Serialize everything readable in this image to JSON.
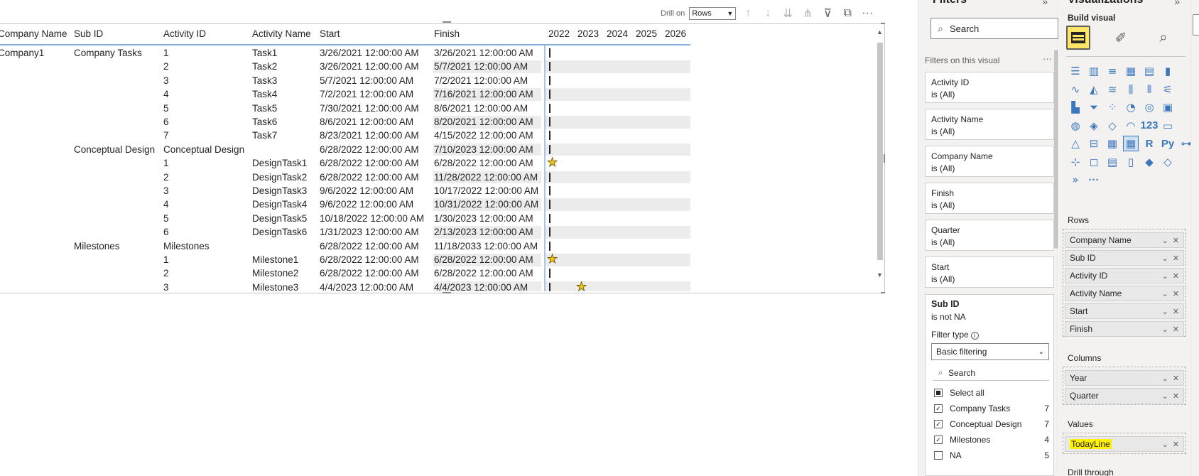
{
  "toolbar": {
    "drill_on_label": "Drill on",
    "drill_on_value": "Rows",
    "icons": [
      "drill-up-icon",
      "drill-down-icon",
      "expand-all-icon",
      "expand-hierarchy-icon",
      "filter-icon",
      "focus-mode-icon",
      "more-options-icon"
    ]
  },
  "matrix": {
    "headers": {
      "company_name": "Company Name",
      "sub_id": "Sub ID",
      "activity_id": "Activity ID",
      "activity_name": "Activity Name",
      "start": "Start",
      "finish": "Finish",
      "years": [
        "2022",
        "2023",
        "2024",
        "2025",
        "2026"
      ]
    },
    "rows": [
      {
        "company": "Company1",
        "sub": "Company Tasks",
        "id": "1",
        "name": "Task1",
        "start": "3/26/2021 12:00:00 AM",
        "finish": "3/26/2021 12:00:00 AM",
        "marker": "tick"
      },
      {
        "company": "",
        "sub": "",
        "id": "2",
        "name": "Task2",
        "start": "3/26/2021 12:00:00 AM",
        "finish": "5/7/2021 12:00:00 AM",
        "marker": "tick"
      },
      {
        "company": "",
        "sub": "",
        "id": "3",
        "name": "Task3",
        "start": "5/7/2021 12:00:00 AM",
        "finish": "7/2/2021 12:00:00 AM",
        "marker": "tick"
      },
      {
        "company": "",
        "sub": "",
        "id": "4",
        "name": "Task4",
        "start": "7/2/2021 12:00:00 AM",
        "finish": "7/16/2021 12:00:00 AM",
        "marker": "tick"
      },
      {
        "company": "",
        "sub": "",
        "id": "5",
        "name": "Task5",
        "start": "7/30/2021 12:00:00 AM",
        "finish": "8/6/2021 12:00:00 AM",
        "marker": "tick"
      },
      {
        "company": "",
        "sub": "",
        "id": "6",
        "name": "Task6",
        "start": "8/6/2021 12:00:00 AM",
        "finish": "8/20/2021 12:00:00 AM",
        "marker": "tick"
      },
      {
        "company": "",
        "sub": "",
        "id": "7",
        "name": "Task7",
        "start": "8/23/2021 12:00:00 AM",
        "finish": "4/15/2022 12:00:00 AM",
        "marker": "tick"
      },
      {
        "company": "",
        "sub": "Conceptual Design",
        "id": "Conceptual Design",
        "name": "",
        "start": "6/28/2022 12:00:00 AM",
        "finish": "7/10/2023 12:00:00 AM",
        "marker": "tick"
      },
      {
        "company": "",
        "sub": "",
        "id": "1",
        "name": "DesignTask1",
        "start": "6/28/2022 12:00:00 AM",
        "finish": "6/28/2022 12:00:00 AM",
        "marker": "star2022"
      },
      {
        "company": "",
        "sub": "",
        "id": "2",
        "name": "DesignTask2",
        "start": "6/28/2022 12:00:00 AM",
        "finish": "11/28/2022 12:00:00 AM",
        "marker": "tick"
      },
      {
        "company": "",
        "sub": "",
        "id": "3",
        "name": "DesignTask3",
        "start": "9/6/2022 12:00:00 AM",
        "finish": "10/17/2022 12:00:00 AM",
        "marker": "tick"
      },
      {
        "company": "",
        "sub": "",
        "id": "4",
        "name": "DesignTask4",
        "start": "9/6/2022 12:00:00 AM",
        "finish": "10/31/2022 12:00:00 AM",
        "marker": "tick"
      },
      {
        "company": "",
        "sub": "",
        "id": "5",
        "name": "DesignTask5",
        "start": "10/18/2022 12:00:00 AM",
        "finish": "1/30/2023 12:00:00 AM",
        "marker": "tick"
      },
      {
        "company": "",
        "sub": "",
        "id": "6",
        "name": "DesignTask6",
        "start": "1/31/2023 12:00:00 AM",
        "finish": "2/13/2023 12:00:00 AM",
        "marker": "tick"
      },
      {
        "company": "",
        "sub": "Milestones",
        "id": "Milestones",
        "name": "",
        "start": "6/28/2022 12:00:00 AM",
        "finish": "11/18/2033 12:00:00 AM",
        "marker": "tick"
      },
      {
        "company": "",
        "sub": "",
        "id": "1",
        "name": "Milestone1",
        "start": "6/28/2022 12:00:00 AM",
        "finish": "6/28/2022 12:00:00 AM",
        "marker": "star2022"
      },
      {
        "company": "",
        "sub": "",
        "id": "2",
        "name": "Milestone2",
        "start": "6/28/2022 12:00:00 AM",
        "finish": "6/28/2022 12:00:00 AM",
        "marker": "tick"
      },
      {
        "company": "",
        "sub": "",
        "id": "3",
        "name": "Milestone3",
        "start": "4/4/2023 12:00:00 AM",
        "finish": "4/4/2023 12:00:00 AM",
        "marker": "tick+star2023"
      }
    ]
  },
  "filters": {
    "title": "Filters",
    "search_placeholder": "Search",
    "section_label": "Filters on this visual",
    "cards": [
      {
        "field": "Activity ID",
        "state": "is (All)"
      },
      {
        "field": "Activity Name",
        "state": "is (All)"
      },
      {
        "field": "Company Name",
        "state": "is (All)"
      },
      {
        "field": "Finish",
        "state": "is (All)"
      },
      {
        "field": "Quarter",
        "state": "is (All)"
      },
      {
        "field": "Start",
        "state": "is (All)"
      }
    ],
    "subid": {
      "field": "Sub ID",
      "state": "is not NA",
      "filter_type_label": "Filter type",
      "filter_type_value": "Basic filtering",
      "search_placeholder": "Search",
      "select_all": "Select all",
      "options": [
        {
          "label": "Company Tasks",
          "count": "7",
          "checked": true
        },
        {
          "label": "Conceptual Design",
          "count": "7",
          "checked": true
        },
        {
          "label": "Milestones",
          "count": "4",
          "checked": true
        },
        {
          "label": "NA",
          "count": "5",
          "checked": false
        }
      ]
    }
  },
  "viz": {
    "title": "Visualizations",
    "build_label": "Build visual",
    "rows_label": "Rows",
    "rows_fields": [
      "Company Name",
      "Sub ID",
      "Activity ID",
      "Activity Name",
      "Start",
      "Finish"
    ],
    "columns_label": "Columns",
    "columns_fields": [
      "Year",
      "Quarter"
    ],
    "values_label": "Values",
    "values_fields": [
      "TodayLine"
    ],
    "drillthrough_label": "Drill through",
    "icon_text": {
      "r": "R",
      "py": "Py",
      "card": "123",
      "more": "···"
    }
  },
  "colors": {
    "accent_yellow": "#ffe566",
    "highlight": "#fff200",
    "header_rule": "#7fb0de",
    "band": "#ececec",
    "star": "#f2c811"
  }
}
